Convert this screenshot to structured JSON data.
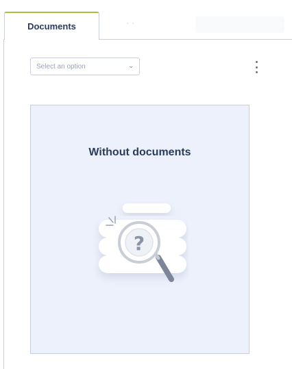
{
  "tabs": [
    {
      "label": "Documents",
      "active": true
    },
    {
      "label": "˙ ˙",
      "active": false
    }
  ],
  "filter": {
    "placeholder": "Select an option"
  },
  "empty_state": {
    "title": "Without documents"
  },
  "colors": {
    "accent": "#a7c23a",
    "title": "#2a3b5c",
    "empty_bg": "#edf1fb",
    "border": "#c9d0db"
  },
  "icons": [
    "chevron-down-icon",
    "more-vertical-icon",
    "magnifier-question-icon"
  ]
}
